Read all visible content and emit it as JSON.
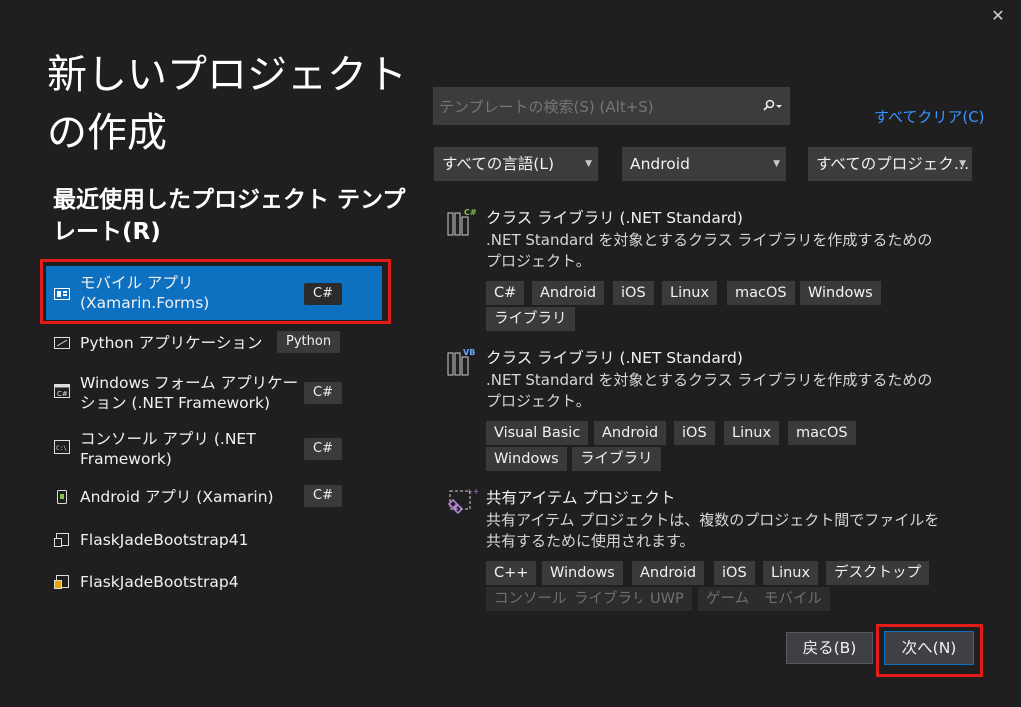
{
  "window": {
    "close_glyph": "✕"
  },
  "title": "新しいプロジェクトの作成",
  "recent": {
    "heading": "最近使用したプロジェクト テンプレート(R)",
    "items": [
      {
        "label": "モバイル アプリ (Xamarin.Forms)",
        "tag": "C#",
        "selected": true,
        "icon": "mobile-app-icon"
      },
      {
        "label": "Python アプリケーション",
        "tag": "Python",
        "selected": false,
        "icon": "python-app-icon"
      },
      {
        "label": "Windows フォーム アプリケーション (.NET Framework)",
        "tag": "C#",
        "selected": false,
        "icon": "windows-forms-icon"
      },
      {
        "label": "コンソール アプリ (.NET Framework)",
        "tag": "C#",
        "selected": false,
        "icon": "console-app-icon"
      },
      {
        "label": "Android アプリ (Xamarin)",
        "tag": "C#",
        "selected": false,
        "icon": "android-app-icon"
      },
      {
        "label": "FlaskJadeBootstrap41",
        "tag": "",
        "selected": false,
        "icon": "flask-template-icon"
      },
      {
        "label": "FlaskJadeBootstrap4",
        "tag": "",
        "selected": false,
        "icon": "flask-template-icon"
      }
    ]
  },
  "search": {
    "placeholder": "テンプレートの検索(S) (Alt+S)",
    "icon": "search-icon"
  },
  "clear_all": "すべてクリア(C)",
  "filters": {
    "language": "すべての言語(L)",
    "platform": "Android",
    "project_type": "すべてのプロジェク…"
  },
  "templates": [
    {
      "name": "クラス ライブラリ (.NET Standard)",
      "desc": ".NET Standard を対象とするクラス ライブラリを作成するためのプロジェクト。",
      "badge": "C#",
      "tags": [
        "C#",
        "Android",
        "iOS",
        "Linux",
        "macOS",
        "Windows",
        "ライブラリ"
      ],
      "dim_tags": []
    },
    {
      "name": "クラス ライブラリ (.NET Standard)",
      "desc": ".NET Standard を対象とするクラス ライブラリを作成するためのプロジェクト。",
      "badge": "VB",
      "tags": [
        "Visual Basic",
        "Android",
        "iOS",
        "Linux",
        "macOS",
        "Windows",
        "ライブラリ"
      ],
      "dim_tags": []
    },
    {
      "name": "共有アイテム プロジェクト",
      "desc": "共有アイテム プロジェクトは、複数のプロジェクト間でファイルを共有するために使用されます。",
      "badge": "",
      "tags": [
        "C++",
        "Windows",
        "Android",
        "iOS",
        "Linux",
        "デスクトップ"
      ],
      "dim_tags": [
        "コンソール",
        "ライブラリ",
        "UWP",
        "ゲーム",
        "モバイル"
      ]
    }
  ],
  "buttons": {
    "back": "戻る(B)",
    "next": "次へ(N)"
  },
  "colors": {
    "background": "#1f1f1f",
    "accent": "#0e70c0",
    "link": "#3794ff",
    "highlight": "#e21b1b"
  }
}
